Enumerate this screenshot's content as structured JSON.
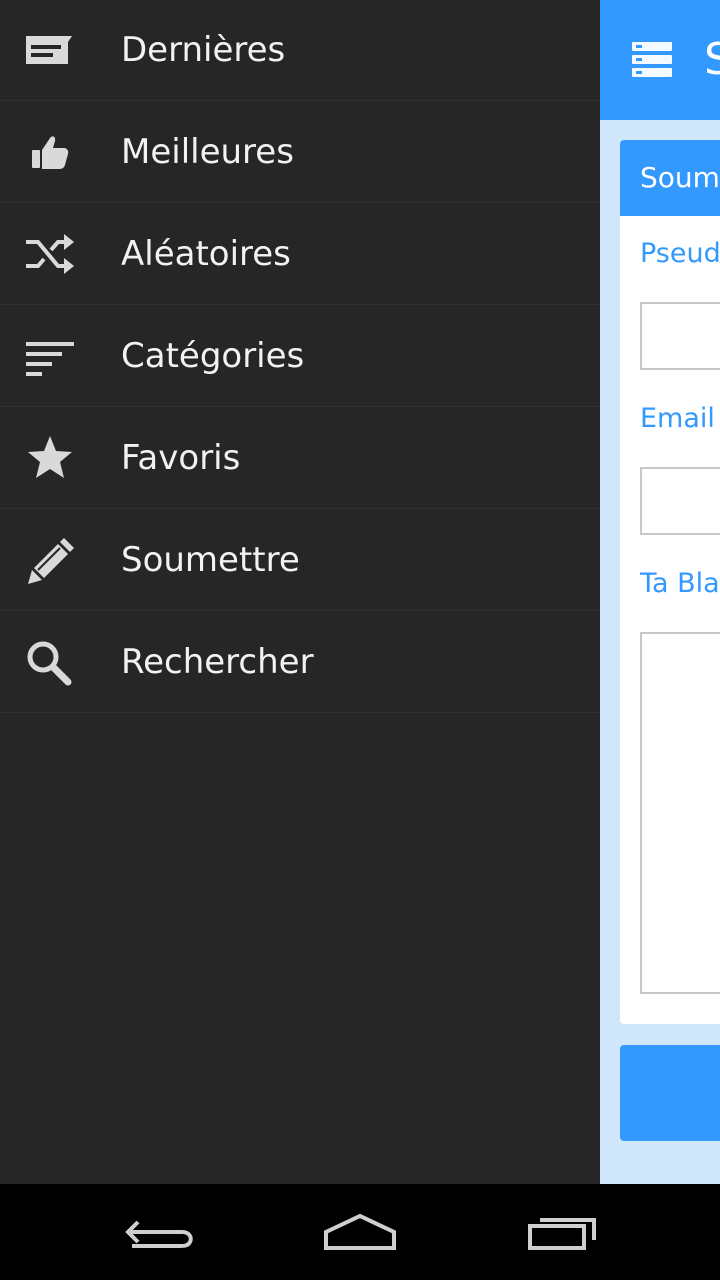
{
  "drawer": {
    "items": [
      {
        "label": "Dernières",
        "icon": "latest-icon"
      },
      {
        "label": "Meilleures",
        "icon": "thumbs-up-icon"
      },
      {
        "label": "Aléatoires",
        "icon": "shuffle-icon"
      },
      {
        "label": "Catégories",
        "icon": "sort-lines-icon"
      },
      {
        "label": "Favoris",
        "icon": "star-icon"
      },
      {
        "label": "Soumettre",
        "icon": "pencil-icon"
      },
      {
        "label": "Rechercher",
        "icon": "search-icon"
      }
    ]
  },
  "app": {
    "title": "S",
    "form": {
      "header": "Soume",
      "pseudo_label": "Pseud",
      "email_label": "Email",
      "joke_label": "Ta Bla"
    }
  },
  "colors": {
    "accent": "#3399ff",
    "drawer_bg": "#262626",
    "content_bg": "#cfe6fb"
  }
}
